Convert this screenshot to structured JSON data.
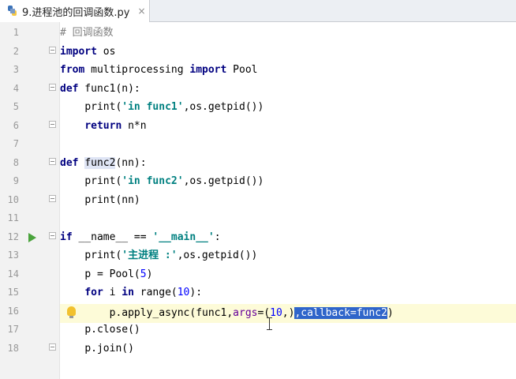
{
  "tab": {
    "filename": "9.进程池的回调函数.py",
    "close_glyph": "×"
  },
  "line_numbers": [
    "1",
    "2",
    "3",
    "4",
    "5",
    "6",
    "7",
    "8",
    "9",
    "10",
    "11",
    "12",
    "13",
    "14",
    "15",
    "16",
    "17",
    "18"
  ],
  "code": {
    "l1": {
      "comment": "# 回调函数"
    },
    "l2": {
      "kw": "import",
      "rest": " os"
    },
    "l3": {
      "kw1": "from",
      "mid": " multiprocessing ",
      "kw2": "import",
      "rest": " Pool"
    },
    "l4": {
      "kw": "def",
      "rest": " func1(n):"
    },
    "l5": {
      "indent": "    ",
      "call": "print(",
      "str": "'in func1'",
      "rest": ",os.getpid())"
    },
    "l6": {
      "indent": "    ",
      "kw": "return",
      "rest": " n*n"
    },
    "l8": {
      "kw": "def",
      "sp": " ",
      "name": "func2",
      "rest": "(nn):"
    },
    "l9": {
      "indent": "    ",
      "call": "print(",
      "str": "'in func2'",
      "rest": ",os.getpid())"
    },
    "l10": {
      "indent": "    ",
      "text": "print(nn)"
    },
    "l12": {
      "kw": "if",
      "mid": " __name__ == ",
      "str": "'__main__'",
      "rest": ":"
    },
    "l13": {
      "indent": "    ",
      "call": "print(",
      "str": "'主进程 :'",
      "rest": ",os.getpid())"
    },
    "l14": {
      "indent": "    ",
      "pre": "p = Pool(",
      "num": "5",
      "rest": ")"
    },
    "l15": {
      "indent": "    ",
      "kw1": "for",
      "mid": " i ",
      "kw2": "in",
      "pre": " range(",
      "num": "10",
      "rest": "):"
    },
    "l16": {
      "indent": "        ",
      "pre": "p.apply_async(func1,",
      "named": "args",
      "eq": "=(",
      "num": "10",
      "rest": ",)",
      "selected": ",callback=func2",
      "close": ")"
    },
    "l17": {
      "indent": "    ",
      "text": "p.close()"
    },
    "l18": {
      "indent": "    ",
      "text": "p.join()"
    }
  },
  "colors": {
    "keyword": "#000080",
    "string": "#008080",
    "number": "#0000ff",
    "comment": "#808080",
    "selection": "#2f65ca",
    "current_line": "#fdfbd8",
    "run_icon": "#4aa33c"
  }
}
